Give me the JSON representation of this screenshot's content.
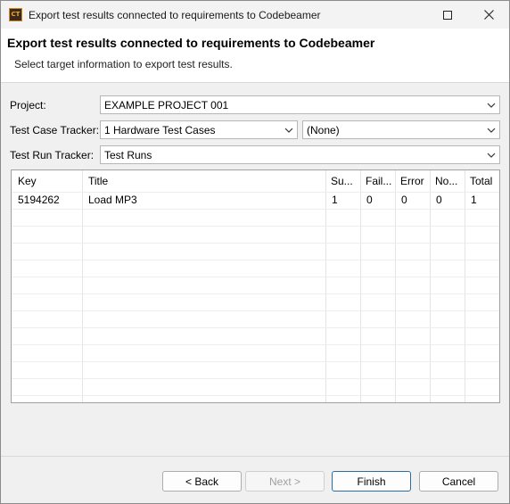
{
  "window": {
    "title": "Export test results connected to requirements to Codebeamer",
    "app_icon_text": "CT"
  },
  "header": {
    "title": "Export test results connected to requirements to Codebeamer",
    "subtitle": "Select target information to export test results."
  },
  "form": {
    "project_label": "Project:",
    "project_value": "EXAMPLE PROJECT 001",
    "test_case_tracker_label": "Test Case Tracker:",
    "test_case_tracker_value": "1 Hardware Test Cases",
    "secondary_value": "(None)",
    "test_run_tracker_label": "Test Run Tracker:",
    "test_run_tracker_value": "Test Runs"
  },
  "table": {
    "columns": [
      "Key",
      "Title",
      "Su...",
      "Fail...",
      "Error",
      "No...",
      "Total"
    ],
    "rows": [
      [
        "5194262",
        "Load MP3",
        "1",
        "0",
        "0",
        "0",
        "1"
      ]
    ]
  },
  "buttons": {
    "back": "< Back",
    "next": "Next >",
    "finish": "Finish",
    "cancel": "Cancel"
  },
  "colors": {
    "primary_border": "#2b6ca3",
    "disabled_text": "#a0a0a0"
  }
}
